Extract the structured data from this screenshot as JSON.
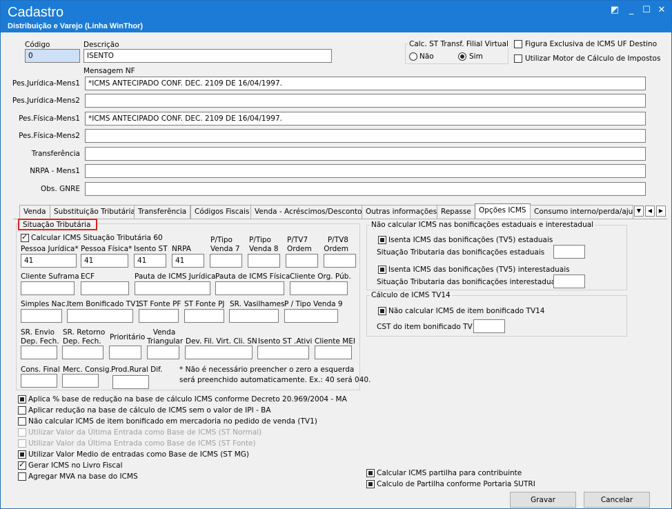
{
  "window": {
    "title": "Cadastro",
    "subtitle": "Distribuição e Varejo (Linha WinThor)"
  },
  "header": {
    "codigo_label": "Código",
    "codigo_value": "0",
    "descricao_label": "Descrição",
    "descricao_value": "ISENTO",
    "mensagem_label": "Mensagem NF"
  },
  "calc_st": {
    "label": "Calc. ST Transf. Filial Virtual",
    "nao": "Não",
    "sim": "Sim"
  },
  "top_checks": [
    "Figura Exclusiva de ICMS UF Destino",
    "Utilizar Motor de Cálculo de Impostos"
  ],
  "messages": [
    {
      "label": "Pes.Jurídica-Mens1",
      "value": "*ICMS ANTECIPADO CONF. DEC. 2109 DE 16/04/1997."
    },
    {
      "label": "Pes.Jurídica-Mens2",
      "value": ""
    },
    {
      "label": "Pes.Física-Mens1",
      "value": "*ICMS ANTECIPADO CONF. DEC. 2109 DE 16/04/1997."
    },
    {
      "label": "Pes.Física-Mens2",
      "value": ""
    },
    {
      "label": "Transferência",
      "value": ""
    },
    {
      "label": "NRPA - Mens1",
      "value": ""
    },
    {
      "label": "Obs. GNRE",
      "value": ""
    }
  ],
  "tabs": [
    "Venda",
    "Substituição Tributária",
    "Transferência",
    "Códigos Fiscais",
    "Venda - Acréscimos/Descontos",
    "Outras informações",
    "Repasse",
    "Opções ICMS",
    "Consumo interno/perda/ajuste"
  ],
  "situacao": {
    "title": "Situação Tributária",
    "calc_label": "Calcular ICMS Situação Tributária 60",
    "row1": [
      {
        "label": "Pessoa Jurídica*",
        "value": "41"
      },
      {
        "label": "Pessoa Física*",
        "value": "41"
      },
      {
        "label": "Isento ST",
        "value": "41"
      },
      {
        "label": "NRPA",
        "value": "41"
      },
      {
        "label": "P/Tipo Venda 7",
        "value": ""
      },
      {
        "label": "P/Tipo Venda 8",
        "value": ""
      },
      {
        "label": "P/TV7 Ordem",
        "value": ""
      },
      {
        "label": "P/TV8 Ordem",
        "value": ""
      }
    ],
    "row2": [
      "Cliente Suframa",
      "ECF",
      "Pauta de ICMS Jurídica",
      "Pauta de ICMS Física",
      "Cliente Org. Púb."
    ],
    "row3": [
      "Simples Nac.",
      "Item Bonificado TV1",
      "ST Fonte PF",
      "ST Fonte PJ",
      "SR. Vasilhames",
      "P / Tipo Venda 9"
    ],
    "row4": [
      "SR. Envio Dep. Fech.",
      "SR. Retorno Dep. Fech.",
      "Prioritário",
      "Venda Triangular",
      "Dev. Fil. Virt. Cli. SN",
      "Isento ST .Ativi",
      "Cliente MEI"
    ],
    "row5": [
      "Cons. Final",
      "Merc. Consig.",
      "Prod.Rural Dif."
    ],
    "note1": "* Não é necessário preencher o zero a esquerda",
    "note2": "será preenchido automaticamente.  Ex.: 40 será 040."
  },
  "bonif": {
    "title": "Não calcular ICMS nas bonificações estaduais e interestadual",
    "c1": "Isenta ICMS das bonificações (TV5) estaduais",
    "s1": "Situação Tributaria das  bonificações estaduais",
    "c2": "Isenta ICMS das bonificações (TV5) interestaduais",
    "s2": "Situação Tributaria das  bonificações interestaduais"
  },
  "tv14": {
    "title": "Cálculo de ICMS TV14",
    "c1": "Não calcular ICMS de item bonificado TV14",
    "cst": "CST do item bonificado TV14"
  },
  "bottom_checks": [
    "Aplica % base de redução na base de cálculo ICMS conforme Decreto 20.969/2004 - MA",
    "Aplicar redução na base de cálculo de ICMS sem o valor de IPI - BA",
    "Não calcular ICMS de item bonificado em mercadoria no pedido de venda (TV1)",
    "Utilizar Valor da Última Entrada como Base de ICMS (ST Normal)",
    "Utilizar Valor da Última Entrada como Base de ICMS (ST Fonte)",
    "Utilizar Valor Medio de entradas como Base de ICMS (ST MG)",
    "Gerar ICMS no Livro Fiscal",
    "Agregar MVA na base do ICMS"
  ],
  "right_checks": [
    "Calcular ICMS partilha para contribuinte",
    "Calculo de Partilha conforme Portaria SUTRI"
  ],
  "buttons": {
    "gravar": "Gravar",
    "cancelar": "Cancelar"
  }
}
